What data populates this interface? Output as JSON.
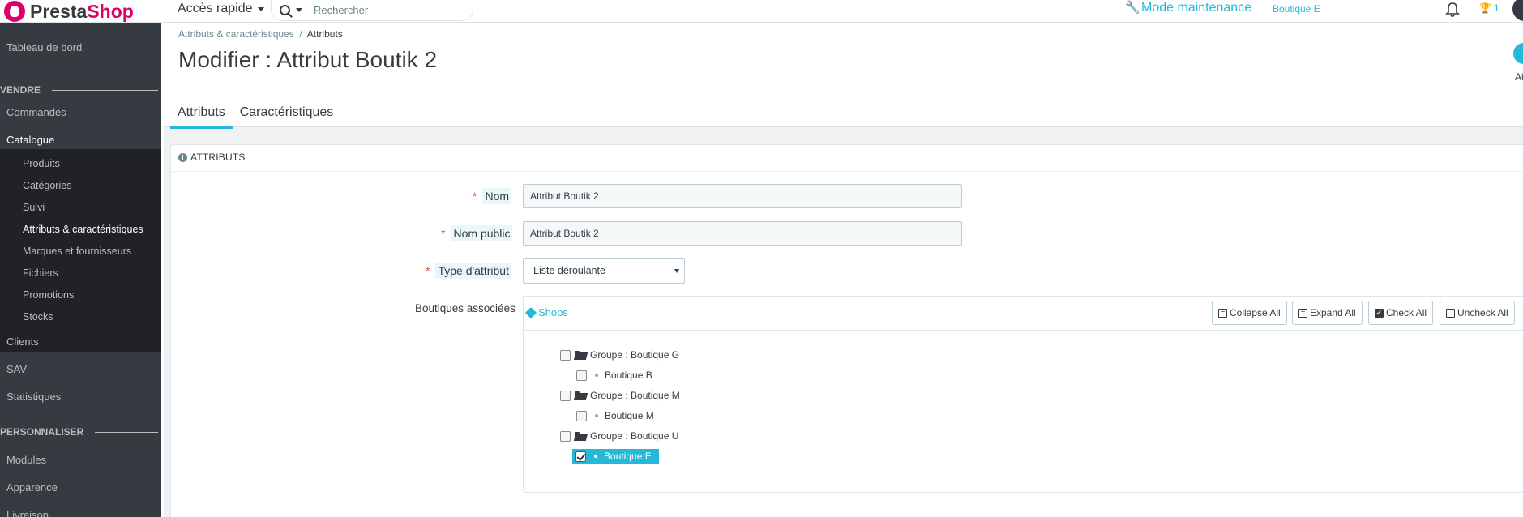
{
  "header": {
    "logo_part1": "Presta",
    "logo_part2": "Shop",
    "quick_access": "Accès rapide",
    "search_placeholder": "Rechercher",
    "maintenance": "Mode maintenance",
    "shop_link": "Boutique E",
    "trophy_count": "1"
  },
  "sidebar": {
    "dashboard": "Tableau de bord",
    "section_sell": "VENDRE",
    "orders": "Commandes",
    "catalog": "Catalogue",
    "catalog_items": [
      "Produits",
      "Catégories",
      "Suivi",
      "Attributs & caractéristiques",
      "Marques et fournisseurs",
      "Fichiers",
      "Promotions",
      "Stocks"
    ],
    "customers": "Clients",
    "sav": "SAV",
    "stats": "Statistiques",
    "section_customize": "PERSONNALISER",
    "modules": "Modules",
    "appearance": "Apparence",
    "shipping": "Livraison"
  },
  "page": {
    "breadcrumb_parent": "Attributs & caractéristiques",
    "breadcrumb_sep": "/",
    "breadcrumb_current": "Attributs",
    "title": "Modifier : Attribut Boutik 2",
    "help_label": "Ai",
    "tabs": [
      "Attributs",
      "Caractéristiques"
    ]
  },
  "form": {
    "panel_title": "ATTRIBUTS",
    "name_label": "Nom",
    "name_value": "Attribut Boutik 2",
    "public_name_label": "Nom public",
    "public_name_value": "Attribut Boutik 2",
    "type_label": "Type d'attribut",
    "type_value": "Liste déroulante",
    "shops_label": "Boutiques associées"
  },
  "tree": {
    "title": "Shops",
    "collapse_all": "Collapse All",
    "expand_all": "Expand All",
    "check_all": "Check All",
    "uncheck_all": "Uncheck All",
    "groups": [
      {
        "label": "Groupe : Boutique G",
        "shop": "Boutique B",
        "checked": false
      },
      {
        "label": "Groupe : Boutique M",
        "shop": "Boutique M",
        "checked": false
      },
      {
        "label": "Groupe : Boutique U",
        "shop": "Boutique E",
        "checked": true
      }
    ]
  },
  "colors": {
    "accent": "#25b9d7",
    "brand": "#df0067",
    "sidebar": "#363a41",
    "required": "#e04a4a"
  }
}
